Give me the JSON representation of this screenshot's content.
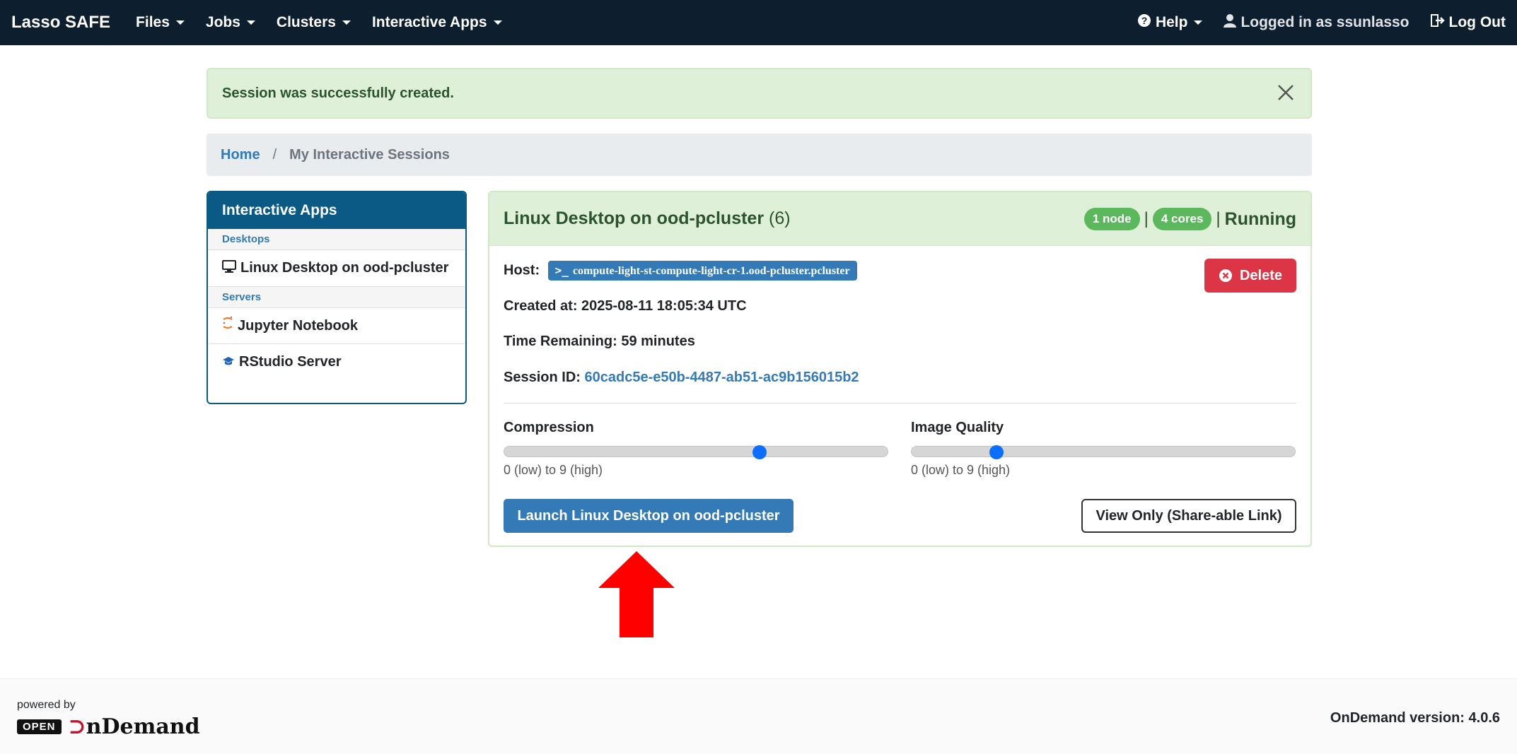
{
  "navbar": {
    "brand": "Lasso SAFE",
    "menus": [
      "Files",
      "Jobs",
      "Clusters",
      "Interactive Apps"
    ],
    "help": "Help",
    "user": "Logged in as ssunlasso",
    "logout": "Log Out"
  },
  "alert": {
    "text": "Session was successfully created."
  },
  "breadcrumb": {
    "home": "Home",
    "current": "My Interactive Sessions"
  },
  "sidebar": {
    "title": "Interactive Apps",
    "cat_desktops": "Desktops",
    "item_linux": "Linux Desktop on ood-pcluster",
    "cat_servers": "Servers",
    "item_jupyter": "Jupyter Notebook",
    "item_rstudio": "RStudio Server"
  },
  "session": {
    "title": "Linux Desktop on ood-pcluster",
    "count": "(6)",
    "nodes_badge": "1 node",
    "cores_badge": "4 cores",
    "status": "Running",
    "host_label": "Host:",
    "host_value": "compute-light-st-compute-light-cr-1.ood-pcluster.pcluster",
    "created": "Created at: 2025-08-11 18:05:34 UTC",
    "remaining": "Time Remaining: 59 minutes",
    "sid_label": "Session ID:",
    "sid_value": "60cadc5e-e50b-4487-ab51-ac9b156015b2",
    "delete_label": "Delete",
    "compression_label": "Compression",
    "compression_value": 6,
    "quality_label": "Image Quality",
    "quality_value": 2,
    "range_hint": "0 (low) to 9 (high)",
    "launch_label": "Launch Linux Desktop on ood-pcluster",
    "view_label": "View Only (Share-able Link)"
  },
  "footer": {
    "powered_by": "powered by",
    "open": "OPEN",
    "ondemand": "OnDemand",
    "version": "OnDemand version: 4.0.6"
  },
  "colors": {
    "navbar": "#0d1e2e",
    "accent": "#337ab7",
    "success": "#5cb85c",
    "danger": "#dc3545",
    "arrow": "#ff0000"
  }
}
